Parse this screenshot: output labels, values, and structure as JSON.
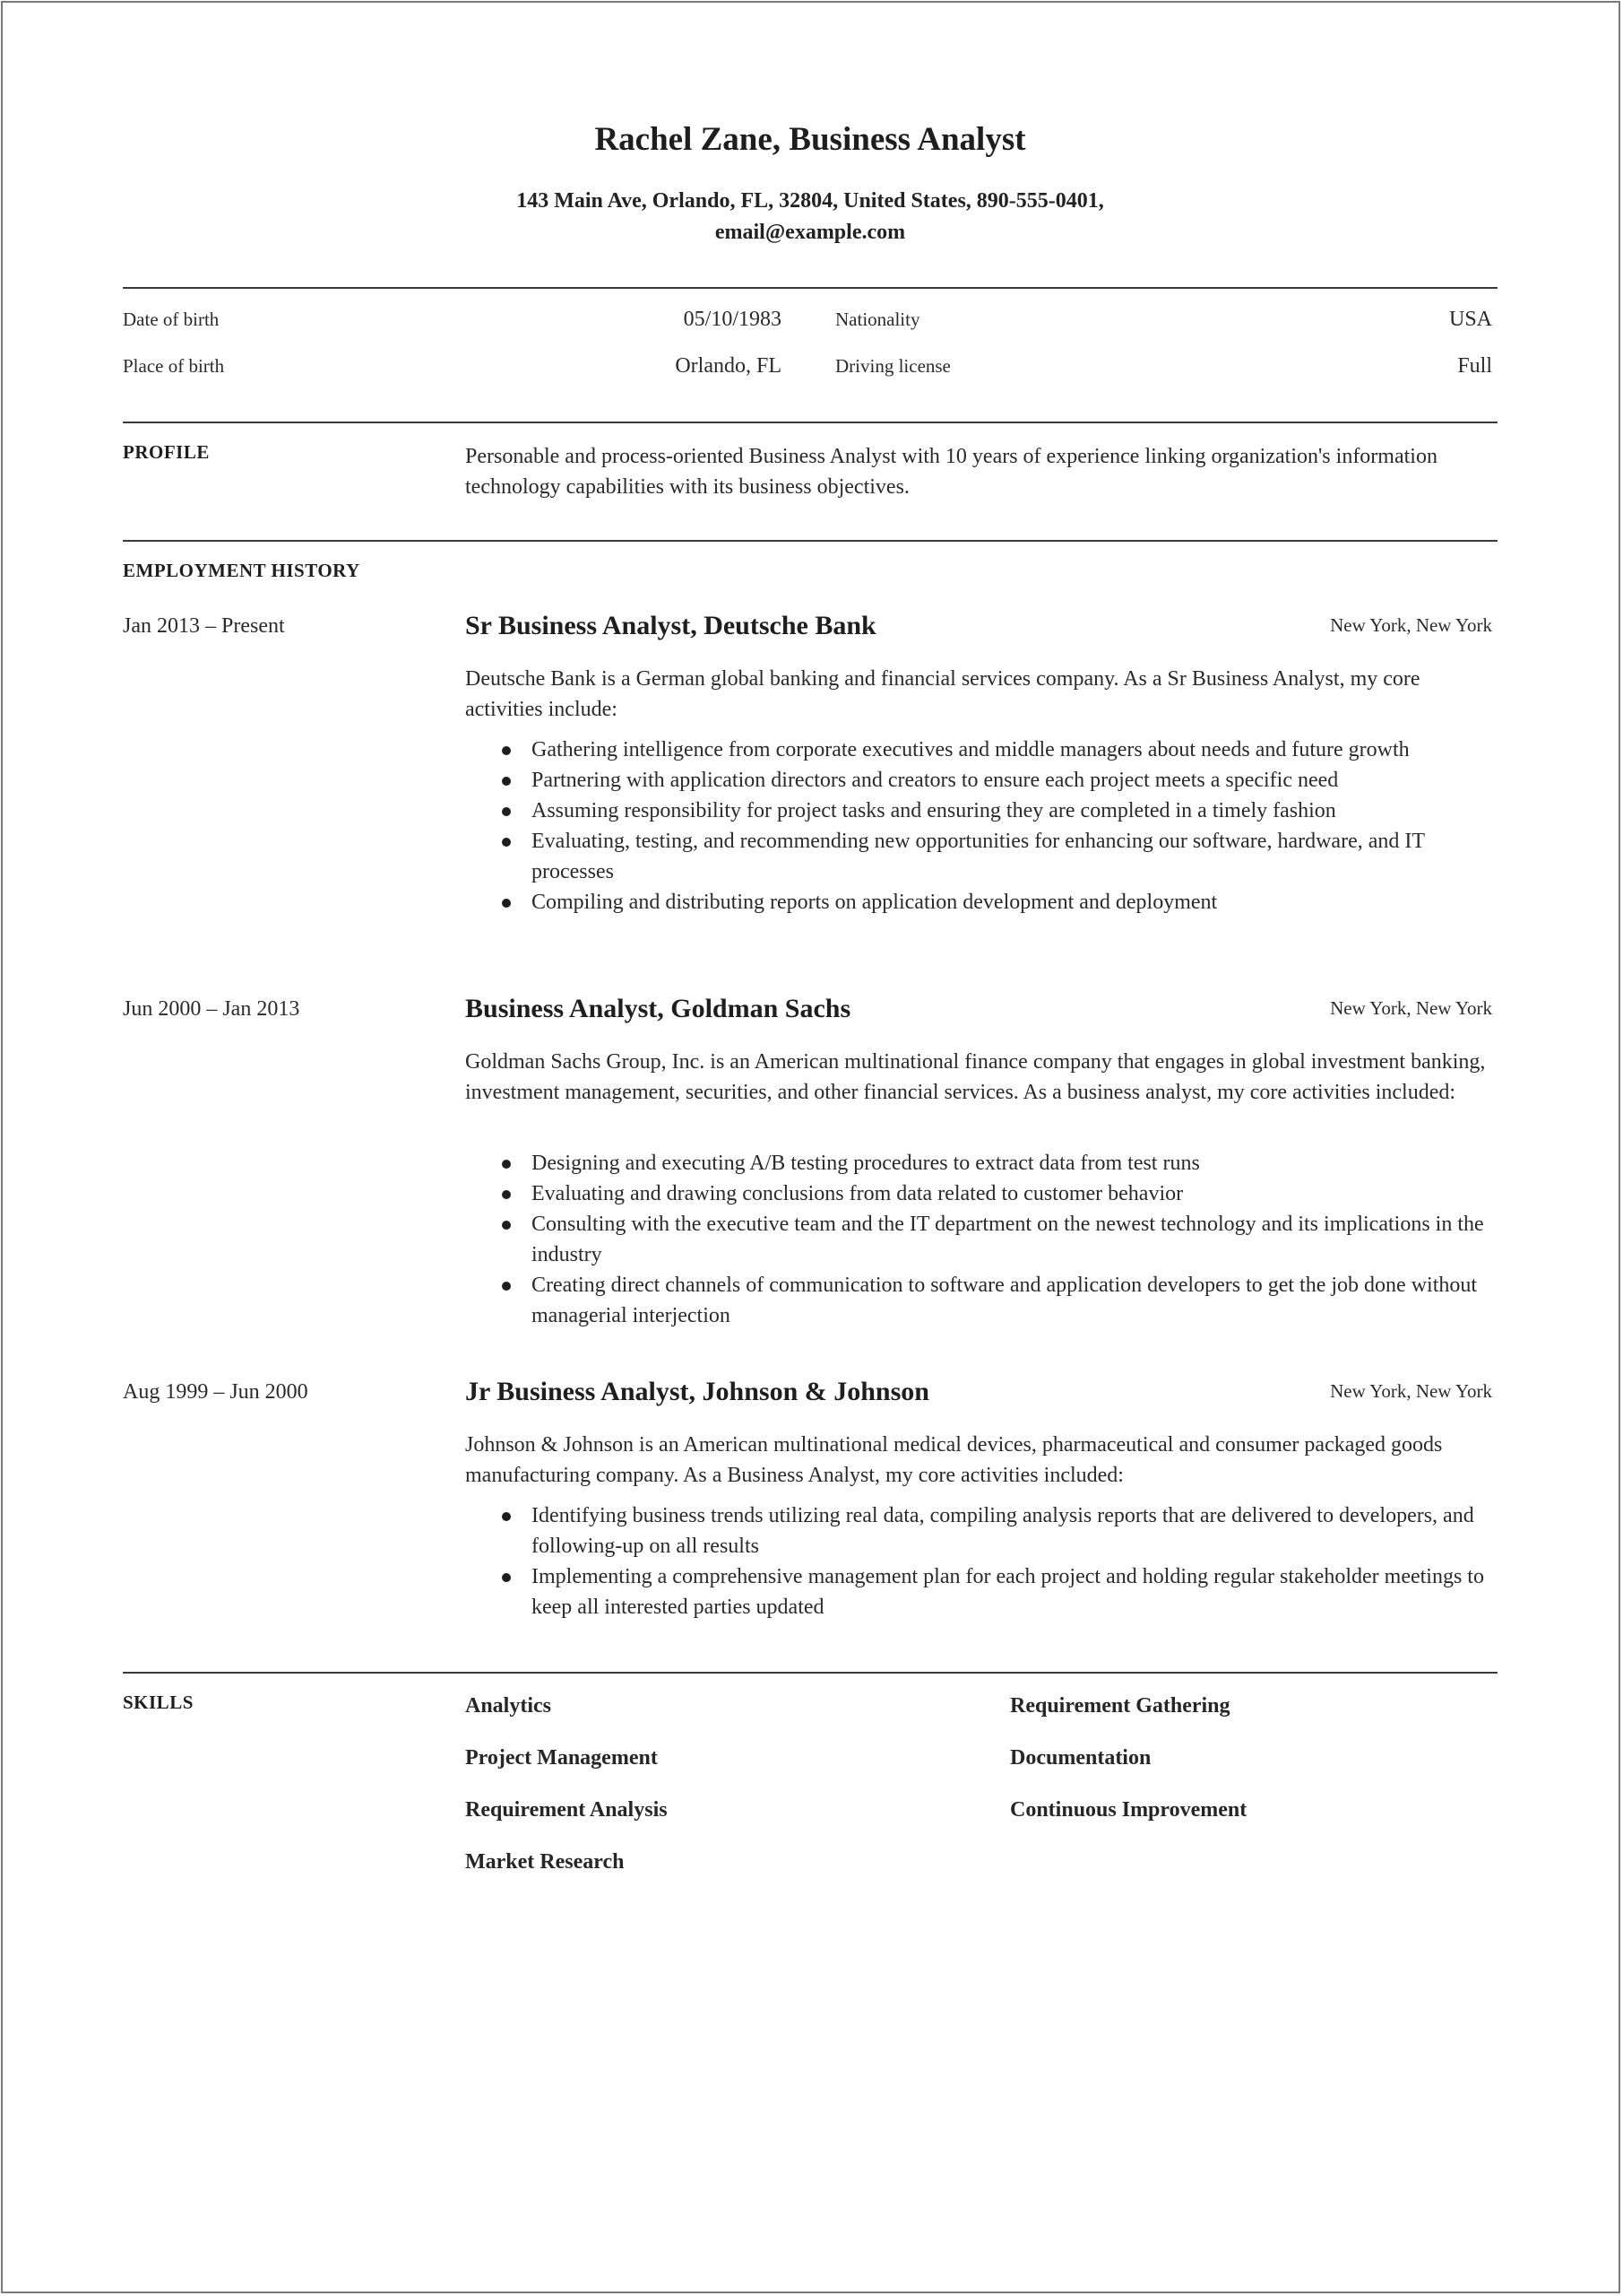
{
  "header": {
    "name_title": "Rachel Zane, Business Analyst",
    "contact_line1": "143 Main Ave, Orlando, FL, 32804, United States, 890-555-0401,",
    "contact_line2": "email@example.com"
  },
  "personal_info": {
    "date_of_birth_label": "Date of birth",
    "date_of_birth": "05/10/1983",
    "place_of_birth_label": "Place of birth",
    "place_of_birth": "Orlando, FL",
    "nationality_label": "Nationality",
    "nationality": "USA",
    "driving_license_label": "Driving license",
    "driving_license": "Full"
  },
  "profile": {
    "heading": "PROFILE",
    "text": "Personable and process-oriented Business Analyst with 10 years of experience linking organization's information technology capabilities with its business objectives."
  },
  "employment": {
    "heading": "EMPLOYMENT HISTORY",
    "jobs": [
      {
        "dates": "Jan 2013 – Present",
        "title": "Sr Business Analyst, Deutsche Bank",
        "location": "New York, New York",
        "description": "Deutsche Bank is a German global banking and financial services company. As a Sr Business Analyst, my core activities include:",
        "bullets": [
          "Gathering intelligence from corporate executives and middle managers about needs and future growth",
          "Partnering with application directors and creators to ensure each project meets a specific need",
          "Assuming responsibility for project tasks and ensuring they are completed in a timely fashion",
          "Evaluating, testing, and recommending new opportunities for enhancing our software, hardware, and IT processes",
          "Compiling and distributing reports on application development and deployment"
        ]
      },
      {
        "dates": "Jun 2000 – Jan 2013",
        "title": "Business Analyst, Goldman Sachs",
        "location": "New York, New York",
        "description": "Goldman Sachs Group, Inc. is an American multinational finance company that engages in global investment banking, investment management, securities, and other financial services. As a business analyst, my core activities included:",
        "bullets": [
          "Designing and executing A/B testing procedures to extract data from test runs",
          "Evaluating and drawing conclusions from data related to customer behavior",
          "Consulting with the executive team and the IT department on the newest technology and its implications in the industry",
          "Creating direct channels of communication to software and application developers to get the job done without managerial interjection"
        ]
      },
      {
        "dates": "Aug 1999 – Jun 2000",
        "title": "Jr Business Analyst, Johnson & Johnson",
        "location": "New York, New York",
        "description": "Johnson & Johnson is an American multinational medical devices, pharmaceutical and consumer packaged goods manufacturing company. As a Business Analyst, my core activities included:",
        "bullets": [
          "Identifying business trends utilizing real data, compiling analysis reports that are delivered to developers, and following-up on all results",
          "Implementing a comprehensive management plan for each project and holding regular stakeholder meetings to keep all interested parties updated"
        ]
      }
    ]
  },
  "skills": {
    "heading": "SKILLS",
    "left": [
      "Analytics",
      "Project Management",
      "Requirement Analysis",
      "Market Research"
    ],
    "right": [
      "Requirement Gathering",
      "Documentation",
      "Continuous Improvement"
    ]
  }
}
